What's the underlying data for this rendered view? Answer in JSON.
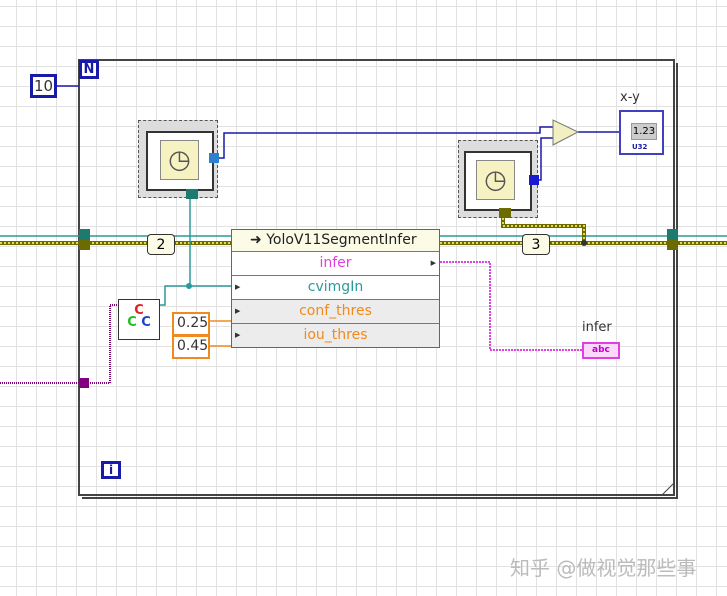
{
  "loop": {
    "count_constant": "10",
    "count_terminal": "N",
    "iteration_terminal": "i"
  },
  "shift_constants": {
    "first": "2",
    "second": "3"
  },
  "node": {
    "title": "YoloV11SegmentInfer",
    "rows": [
      {
        "label": "infer",
        "color": "#e040e0"
      },
      {
        "label": "cvimgIn",
        "color": "#2a9a9a"
      },
      {
        "label": "conf_thres",
        "color": "#f08a1c"
      },
      {
        "label": "iou_thres",
        "color": "#f08a1c"
      }
    ]
  },
  "constants": {
    "conf": "0.25",
    "iou": "0.45"
  },
  "subtract": {
    "symbol": "-"
  },
  "indicators": {
    "xy": {
      "label": "x-y",
      "value": "1.23",
      "type": "U32"
    },
    "infer": {
      "label": "infer",
      "type": "abc"
    }
  },
  "icons": [
    "tick-count-icon",
    "opencv-image-icon",
    "subtract-icon"
  ],
  "watermark": "知乎 @做视觉那些事"
}
